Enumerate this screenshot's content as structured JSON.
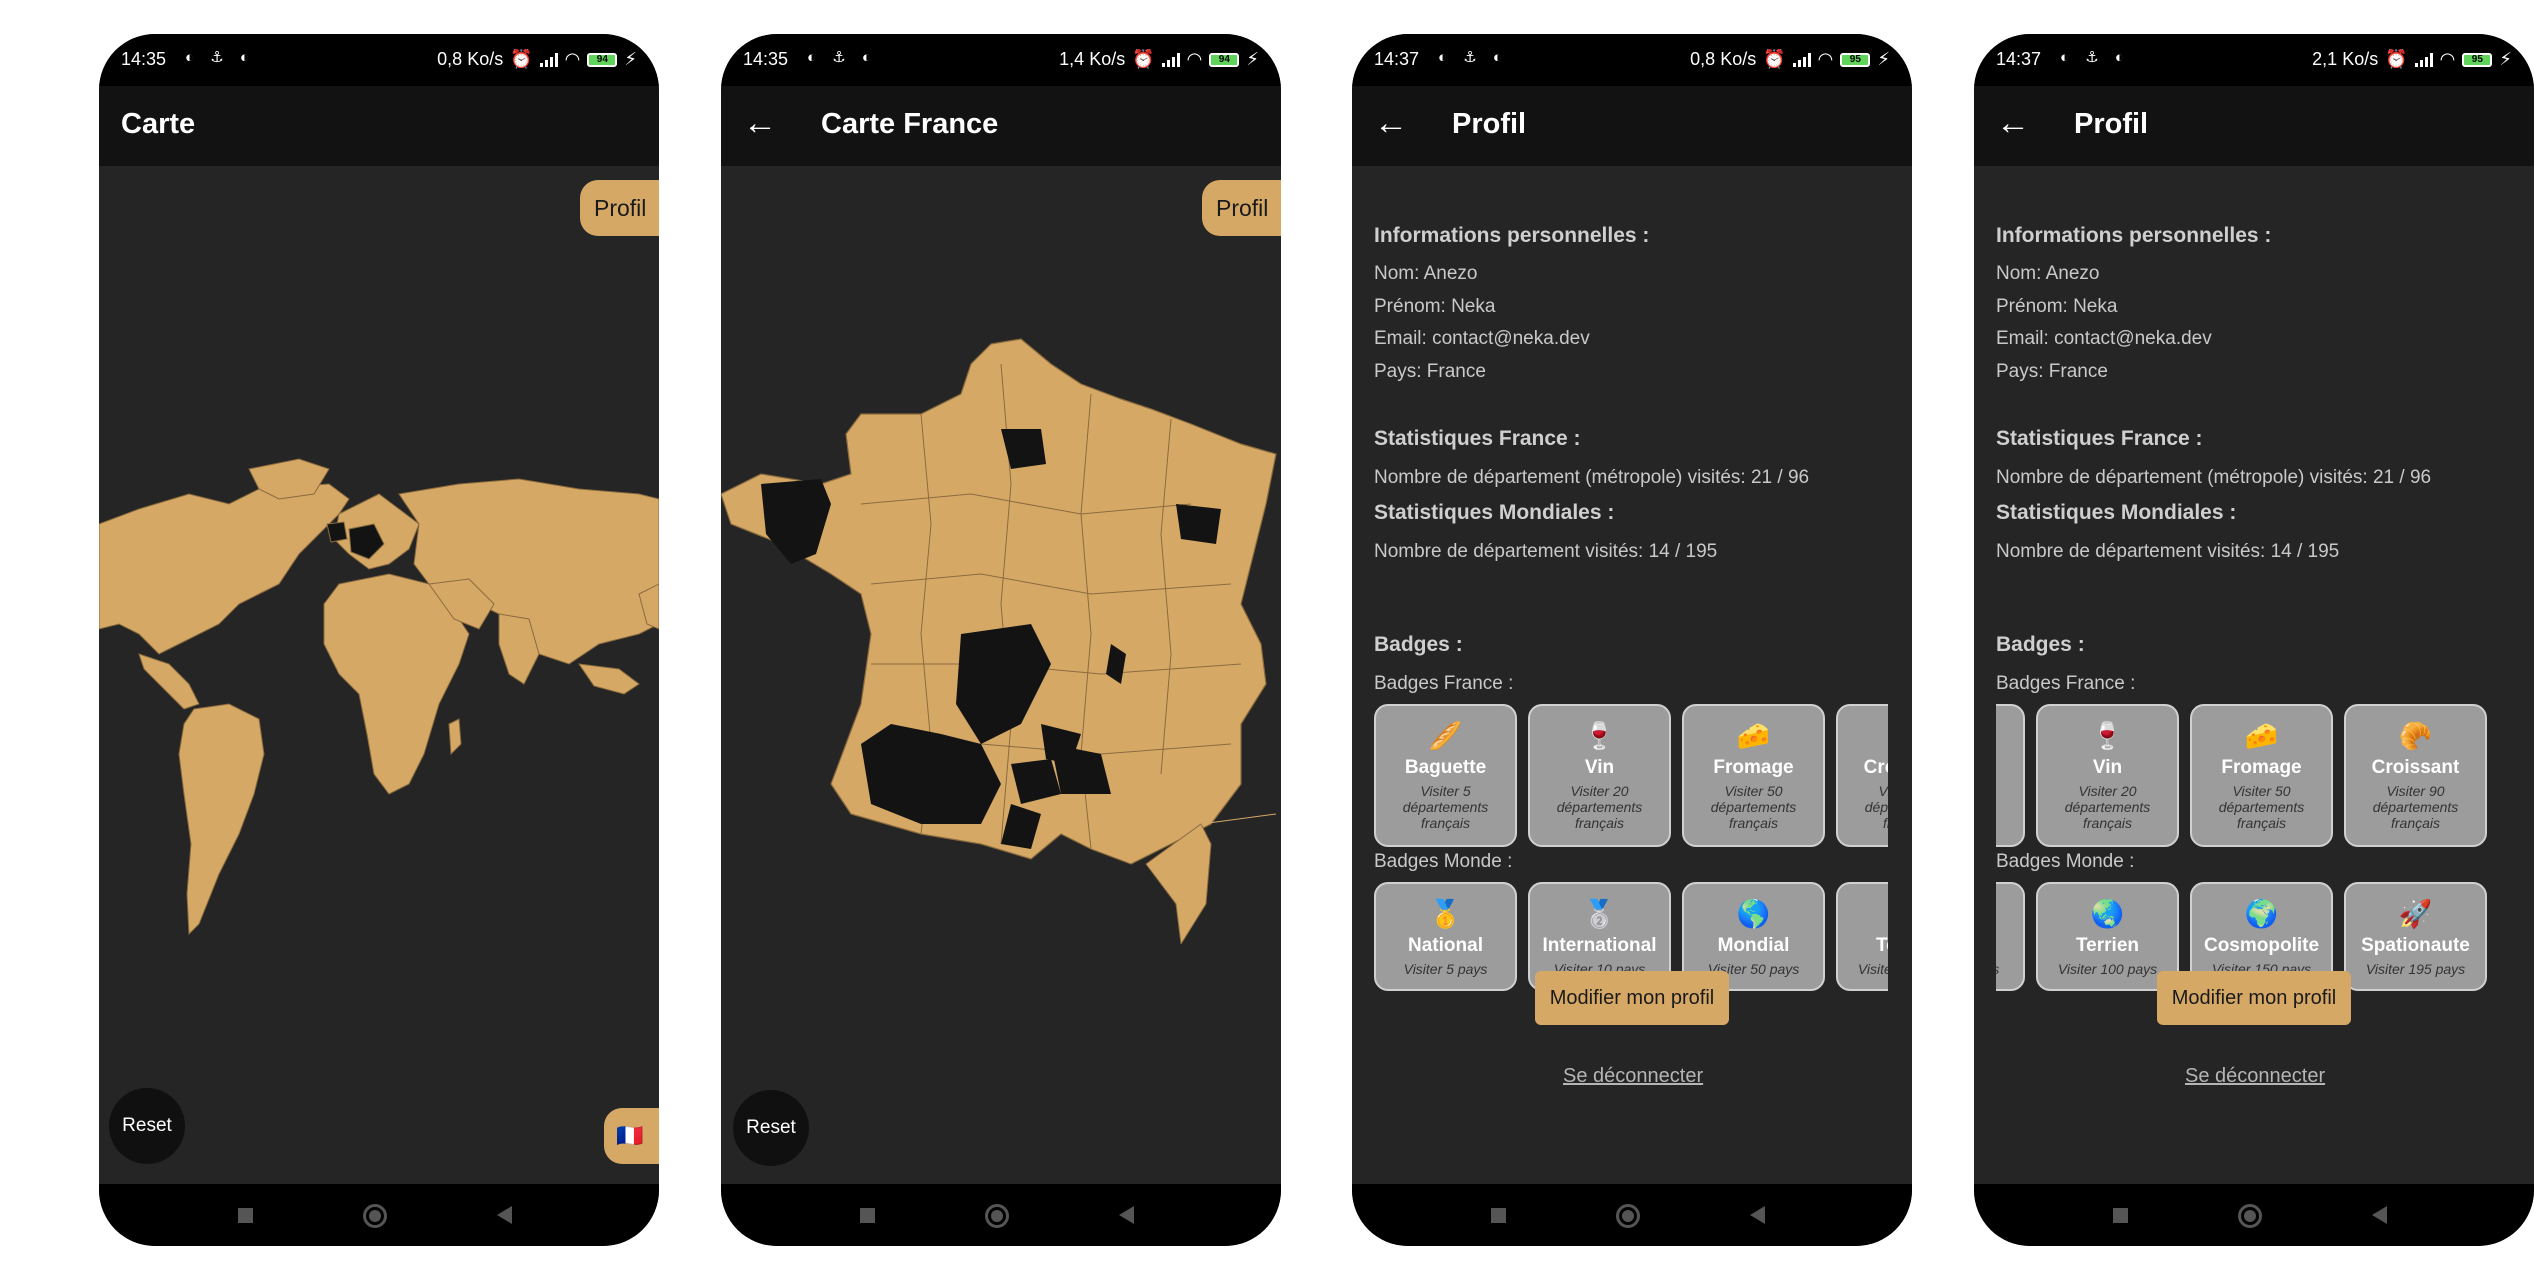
{
  "colors": {
    "accent": "#d6a866",
    "background": "#252525",
    "appbar": "#121212",
    "visited": "#131313"
  },
  "screens": [
    {
      "status": {
        "time": "14:35",
        "speed": "0,8 Ko/s",
        "battery": "94"
      },
      "title": "Carte",
      "profile_label": "Profil",
      "reset_label": "Reset",
      "flag": "🇫🇷"
    },
    {
      "status": {
        "time": "14:35",
        "speed": "1,4 Ko/s",
        "battery": "94"
      },
      "title": "Carte France",
      "profile_label": "Profil",
      "reset_label": "Reset"
    },
    {
      "status": {
        "time": "14:37",
        "speed": "0,8 Ko/s",
        "battery": "95"
      },
      "title": "Profil"
    },
    {
      "status": {
        "time": "14:37",
        "speed": "2,1 Ko/s",
        "battery": "95"
      },
      "title": "Profil"
    }
  ],
  "profile": {
    "personal_header": "Informations personnelles :",
    "nom": "Nom: Anezo",
    "prenom": "Prénom: Neka",
    "email": "Email: contact@neka.dev",
    "pays": "Pays: France",
    "stats_fr_header": "Statistiques France :",
    "stats_fr_text": "Nombre de département (métropole) visités: 21 / 96",
    "stats_world_header": "Statistiques Mondiales :",
    "stats_world_text": "Nombre de département visités: 14 / 195",
    "badges_header": "Badges :",
    "badges_fr_label": "Badges France :",
    "badges_world_label": "Badges Monde :",
    "edit_button": "Modifier mon profil",
    "logout": "Se déconnecter",
    "badges_fr": [
      {
        "icon": "🥖",
        "name": "Baguette",
        "desc": "Visiter 5 départements français"
      },
      {
        "icon": "🍷",
        "name": "Vin",
        "desc": "Visiter 20 départements français"
      },
      {
        "icon": "🧀",
        "name": "Fromage",
        "desc": "Visiter 50 départements français"
      },
      {
        "icon": "🥐",
        "name": "Croissant",
        "desc": "Visiter 90 départements français"
      }
    ],
    "badges_world": [
      {
        "icon": "🥇",
        "name": "National",
        "desc": "Visiter 5 pays"
      },
      {
        "icon": "🥈",
        "name": "International",
        "desc": "Visiter 10 pays"
      },
      {
        "icon": "🌎",
        "name": "Mondial",
        "desc": "Visiter 50 pays"
      },
      {
        "icon": "🌏",
        "name": "Terrien",
        "desc": "Visiter 100 pays"
      },
      {
        "icon": "🌍",
        "name": "Cosmopolite",
        "desc": "Visiter 150 pays"
      },
      {
        "icon": "🚀",
        "name": "Spationaute",
        "desc": "Visiter 195 pays"
      }
    ]
  }
}
